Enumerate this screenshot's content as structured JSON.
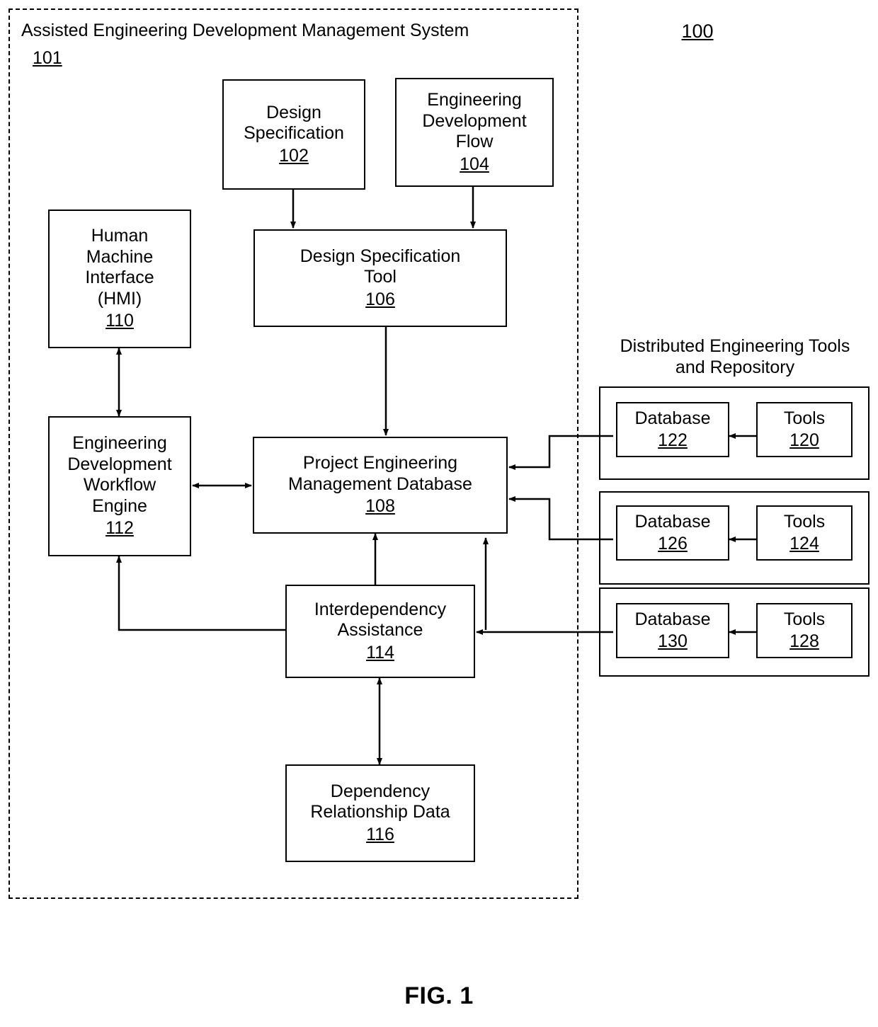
{
  "figure": {
    "caption": "FIG. 1",
    "system_ref": "100"
  },
  "system_boundary": {
    "title": "Assisted Engineering Development Management System",
    "ref": "101"
  },
  "blocks": {
    "design_specification": {
      "line1": "Design",
      "line2": "Specification",
      "ref": "102"
    },
    "engineering_development_flow": {
      "line1": "Engineering",
      "line2": "Development",
      "line3": "Flow",
      "ref": "104"
    },
    "design_specification_tool": {
      "line1": "Design Specification",
      "line2": "Tool",
      "ref": "106"
    },
    "human_machine_interface": {
      "line1": "Human",
      "line2": "Machine",
      "line3": "Interface",
      "line4": "(HMI)",
      "ref": "110"
    },
    "engineering_development_workflow_engine": {
      "line1": "Engineering",
      "line2": "Development",
      "line3": "Workflow",
      "line4": "Engine",
      "ref": "112"
    },
    "project_engineering_management_database": {
      "line1": "Project Engineering",
      "line2": "Management Database",
      "ref": "108"
    },
    "interdependency_assistance": {
      "line1": "Interdependency",
      "line2": "Assistance",
      "ref": "114"
    },
    "dependency_relationship_data": {
      "line1": "Dependency",
      "line2": "Relationship Data",
      "ref": "116"
    }
  },
  "distributed_group": {
    "title_line1": "Distributed Engineering Tools",
    "title_line2": "and Repository",
    "pairs": [
      {
        "database_label": "Database",
        "database_ref": "122",
        "tools_label": "Tools",
        "tools_ref": "120"
      },
      {
        "database_label": "Database",
        "database_ref": "126",
        "tools_label": "Tools",
        "tools_ref": "124"
      },
      {
        "database_label": "Database",
        "database_ref": "130",
        "tools_label": "Tools",
        "tools_ref": "128"
      }
    ]
  }
}
